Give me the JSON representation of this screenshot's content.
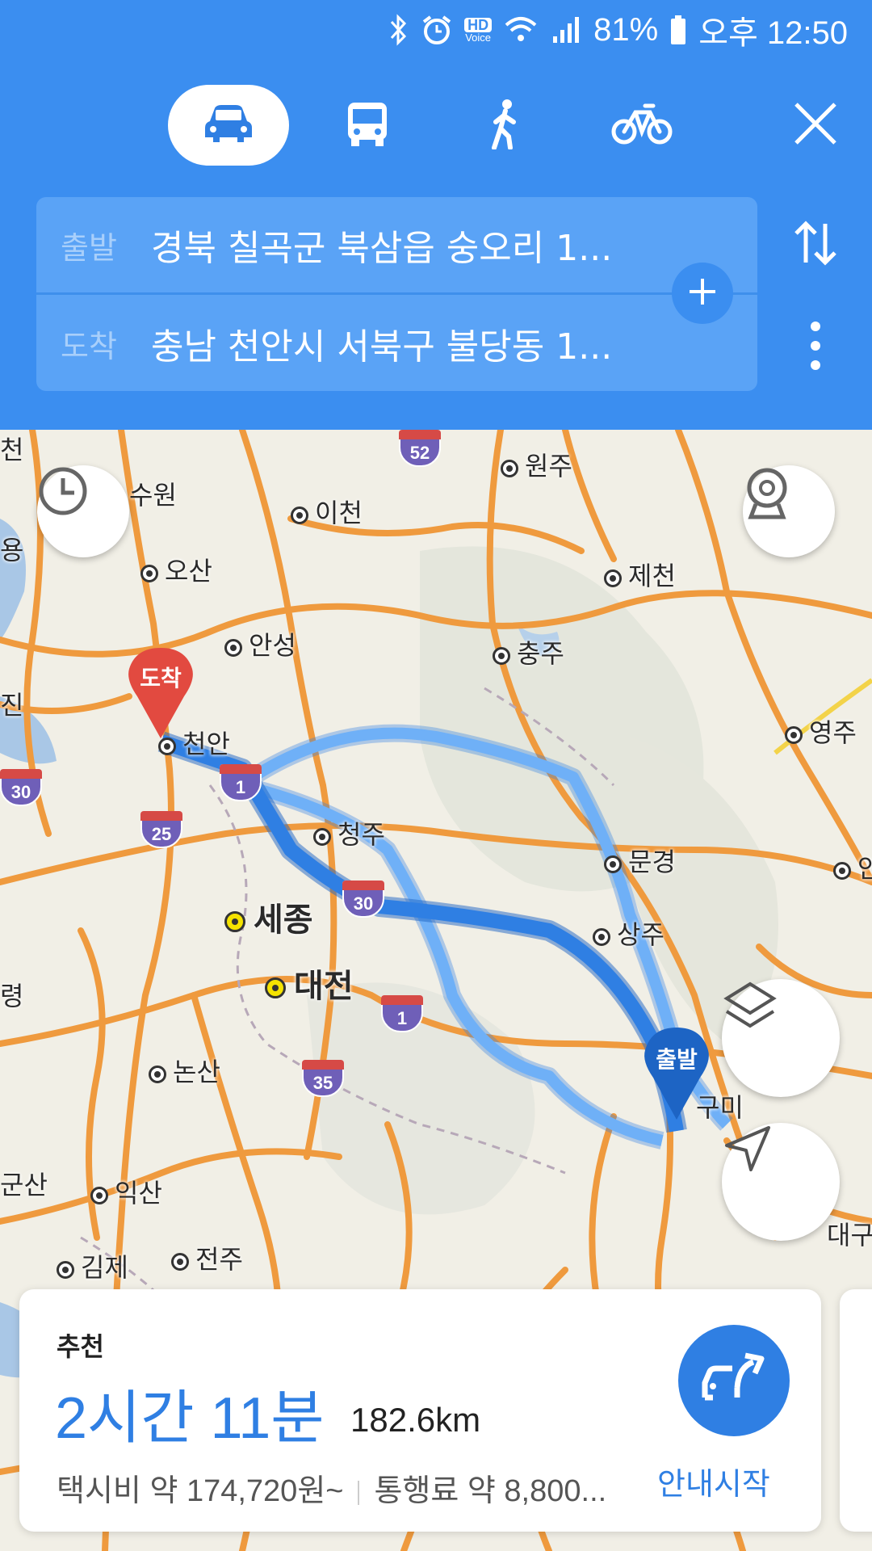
{
  "status": {
    "battery": "81%",
    "time": "오후 12:50",
    "hd_label": "HD",
    "voice_label": "Voice"
  },
  "transport_modes": [
    {
      "name": "car",
      "icon": "car-icon",
      "selected": true
    },
    {
      "name": "bus",
      "icon": "bus-icon",
      "selected": false
    },
    {
      "name": "walk",
      "icon": "walk-icon",
      "selected": false
    },
    {
      "name": "bike",
      "icon": "bike-icon",
      "selected": false
    }
  ],
  "route": {
    "origin_tag": "출발",
    "origin": "경북 칠곡군 북삼읍 숭오리 1...",
    "dest_tag": "도착",
    "dest": "충남 천안시 서북구 불당동 1..."
  },
  "map": {
    "cities": [
      "천안",
      "수원",
      "오산",
      "안성",
      "이천",
      "원주",
      "제천",
      "충주",
      "영주",
      "청주",
      "문경",
      "상주",
      "구미",
      "세종",
      "대전",
      "논산",
      "군산",
      "익산",
      "김제",
      "전주",
      "대구",
      "진",
      "령",
      "안",
      "천",
      "용"
    ],
    "highways": [
      "1",
      "25",
      "30",
      "30",
      "1",
      "35",
      "52"
    ],
    "pin_origin": "출발",
    "pin_dest": "도착",
    "accent": "#3b8ef0",
    "route_main": "#2f7fe3",
    "route_alt": "#6fb0f7"
  },
  "result": {
    "tag": "추천",
    "duration": "2시간 11분",
    "distance": "182.6km",
    "taxi": "택시비 약 174,720원~",
    "toll": "통행료 약 8,800...",
    "start_label": "안내시작"
  }
}
